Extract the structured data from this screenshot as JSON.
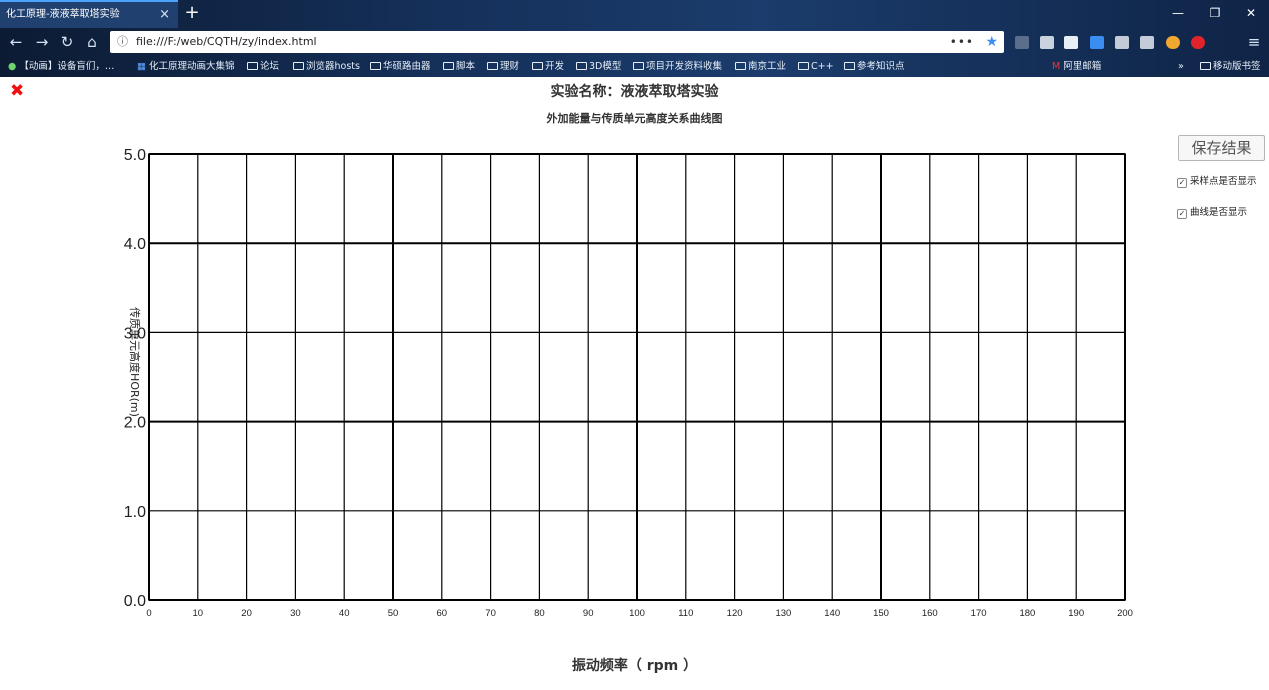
{
  "browser": {
    "tab_title": "化工原理-液液萃取塔实验",
    "tab_close": "×",
    "new_tab": "+",
    "url": "file:///F:/web/CQTH/zy/index.html",
    "url_more": "•••",
    "bookmarks": [
      {
        "label": "【动画】设备盲们，…"
      },
      {
        "label": "化工原理动画大集锦"
      },
      {
        "label": "论坛"
      },
      {
        "label": "浏览器hosts"
      },
      {
        "label": "华硕路由器"
      },
      {
        "label": "脚本"
      },
      {
        "label": "理财"
      },
      {
        "label": "开发"
      },
      {
        "label": "3D模型"
      },
      {
        "label": "项目开发资料收集"
      },
      {
        "label": "南京工业"
      },
      {
        "label": "C++"
      },
      {
        "label": "参考知识点"
      },
      {
        "label": "阿里邮箱"
      }
    ],
    "bookmark_more": "»",
    "mobile_bookmarks": "移动版书签",
    "accent": "#4aa3ff"
  },
  "page": {
    "title": "实验名称：液液萃取塔实验",
    "save_label": "保存结果",
    "options": [
      {
        "label": "采样点是否显示",
        "checked": true
      },
      {
        "label": "曲线是否显示",
        "checked": true
      }
    ]
  },
  "chart_data": {
    "type": "line",
    "title": "外加能量与传质单元高度关系曲线图",
    "xlabel": "振动频率（ rpm ）",
    "ylabel": "传质单元高度HOR(m)",
    "xlim": [
      0,
      200
    ],
    "ylim": [
      0,
      5
    ],
    "xticks": [
      0,
      10,
      20,
      30,
      40,
      50,
      60,
      70,
      80,
      90,
      100,
      110,
      120,
      130,
      140,
      150,
      160,
      170,
      180,
      190,
      200
    ],
    "yticks": [
      "0.0",
      "1.0",
      "2.0",
      "3.0",
      "4.0",
      "5.0"
    ],
    "grid": true,
    "series": []
  }
}
